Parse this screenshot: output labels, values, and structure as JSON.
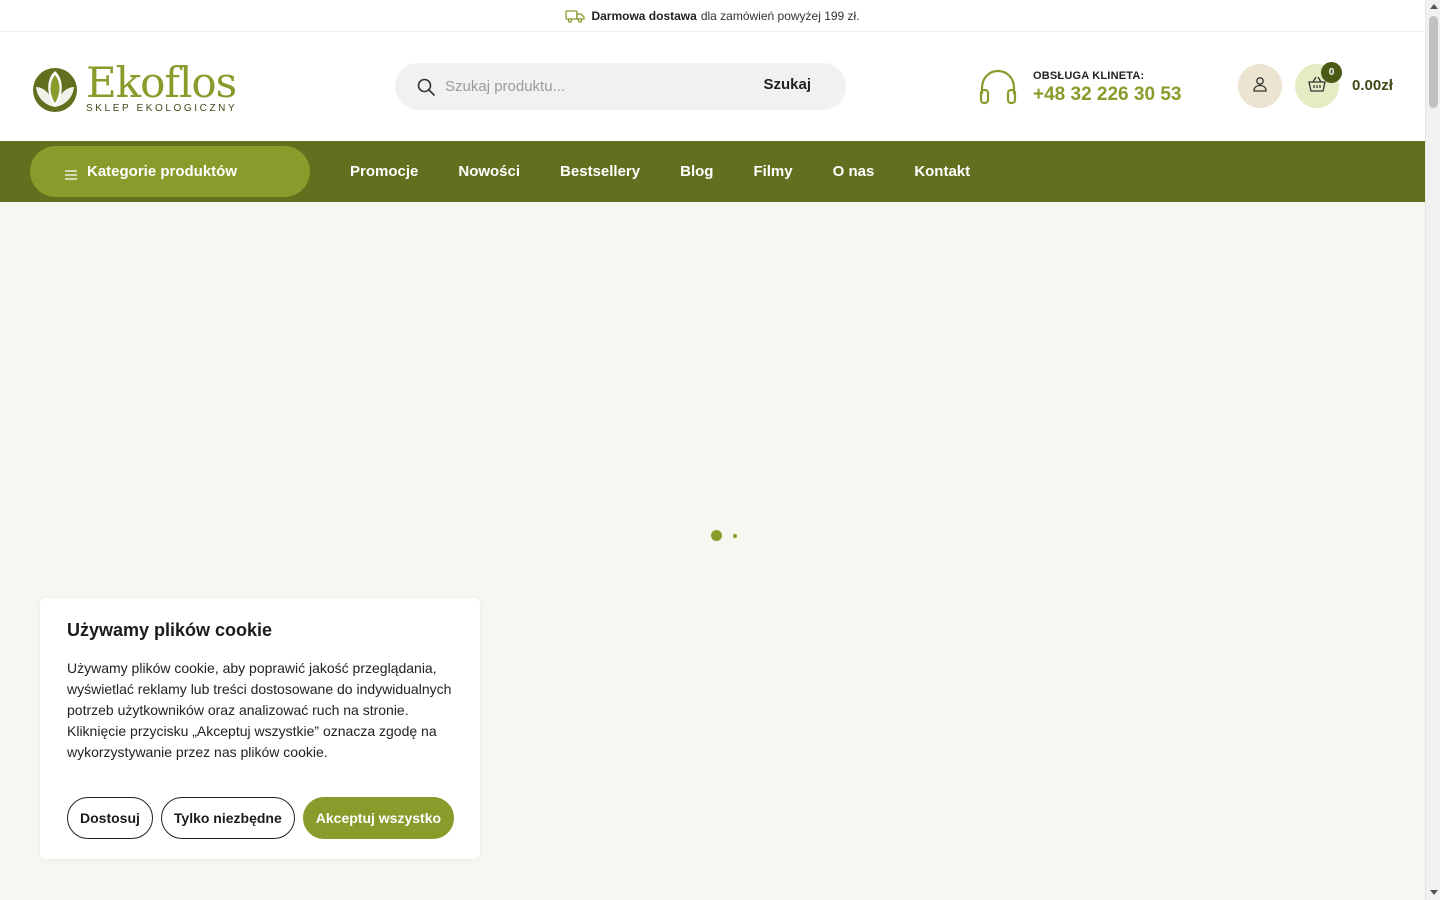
{
  "topbar": {
    "highlight": "Darmowa dostawa",
    "text": "dla zamówień powyżej 199 zł."
  },
  "header": {
    "logo": {
      "name": "Ekoflos",
      "tagline": "SKLEP EKOLOGICZNY"
    },
    "search": {
      "placeholder": "Szukaj produktu...",
      "button": "Szukaj"
    },
    "support": {
      "label": "OBSŁUGA KLINETA:",
      "phone": "+48 32 226 30 53"
    },
    "cart": {
      "count": "0",
      "total": "0.00zł"
    }
  },
  "nav": {
    "categories_label": "Kategorie produktów",
    "links": [
      "Promocje",
      "Nowości",
      "Bestsellery",
      "Blog",
      "Filmy",
      "O nas",
      "Kontakt"
    ]
  },
  "cookie": {
    "title": "Używamy plików cookie",
    "body": "Używamy plików cookie, aby poprawić jakość przeglądania, wyświetlać reklamy lub treści dostosowane do indywidualnych potrzeb użytkowników oraz analizować ruch na stronie. Kliknięcie przycisku „Akceptuj wszystkie” oznacza zgodę na wykorzystywanie przez nas plików cookie.",
    "buttons": {
      "customize": "Dostosuj",
      "necessary": "Tylko niezbędne",
      "accept": "Akceptuj wszystko"
    }
  },
  "colors": {
    "brand_green": "#8a9a2b",
    "nav_green": "#636f1e",
    "dark_green": "#3f4a17",
    "page_bg": "#f7f7f2"
  },
  "icons": {
    "delivery": "truck-icon",
    "search": "search-icon",
    "support": "headset-icon",
    "account": "user-icon",
    "cart": "basket-icon",
    "menu": "hamburger-icon"
  }
}
